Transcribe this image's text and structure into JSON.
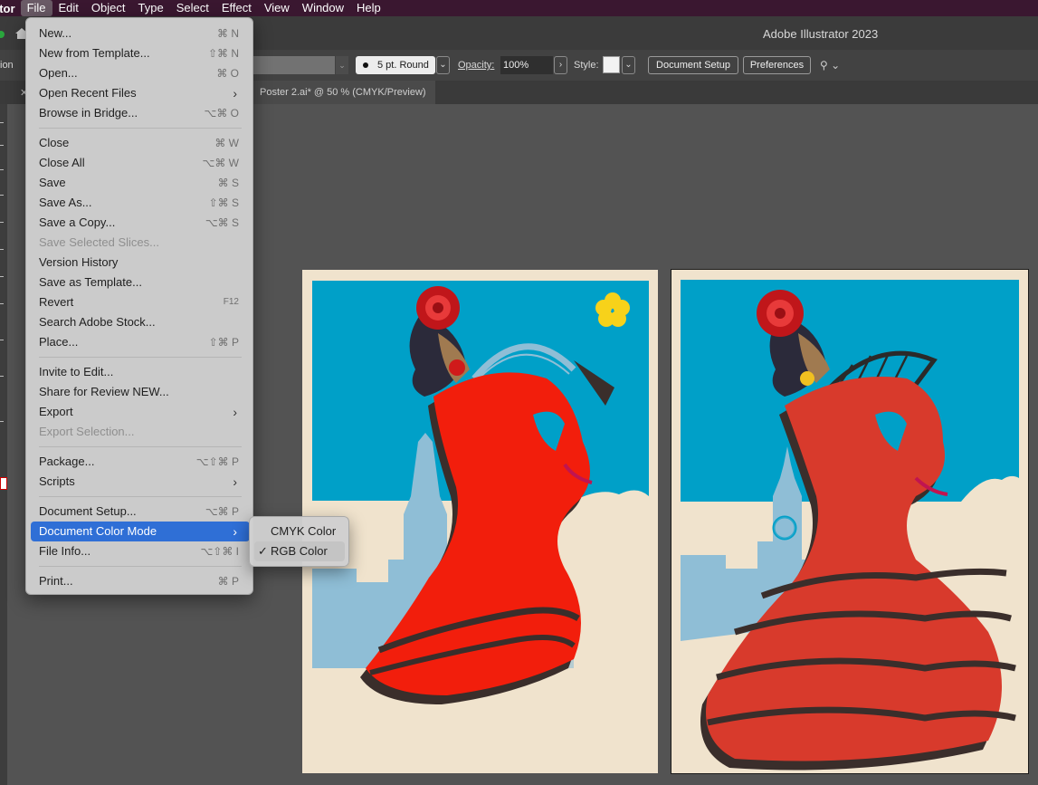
{
  "menubar": {
    "app_name": "Illustrator",
    "items": [
      "File",
      "Edit",
      "Object",
      "Type",
      "Select",
      "Effect",
      "View",
      "Window",
      "Help"
    ]
  },
  "titlebar": {
    "title": "Adobe Illustrator 2023"
  },
  "controlbar": {
    "left_label": "Selection",
    "stroke_profile": "5 pt. Round",
    "opacity_label": "Opacity:",
    "opacity_value": "100%",
    "style_label": "Style:",
    "document_setup": "Document Setup",
    "preferences": "Preferences"
  },
  "tabs": [
    {
      "label": "Poster 2.ai* @ 50 % (CMYK/Preview)"
    }
  ],
  "file_menu": {
    "items": [
      {
        "label": "New...",
        "shortcut": "⌘ N"
      },
      {
        "label": "New from Template...",
        "shortcut": "⇧⌘ N"
      },
      {
        "label": "Open...",
        "shortcut": "⌘ O"
      },
      {
        "label": "Open Recent Files",
        "shortcut": "›"
      },
      {
        "label": "Browse in Bridge...",
        "shortcut": "⌥⌘ O"
      },
      {
        "label": "Close",
        "shortcut": "⌘ W"
      },
      {
        "label": "Close All",
        "shortcut": "⌥⌘ W"
      },
      {
        "label": "Save",
        "shortcut": "⌘ S"
      },
      {
        "label": "Save As...",
        "shortcut": "⇧⌘ S"
      },
      {
        "label": "Save a Copy...",
        "shortcut": "⌥⌘ S"
      },
      {
        "label": "Save Selected Slices...",
        "shortcut": ""
      },
      {
        "label": "Version History",
        "shortcut": ""
      },
      {
        "label": "Save as Template...",
        "shortcut": ""
      },
      {
        "label": "Revert",
        "shortcut": "F12"
      },
      {
        "label": "Search Adobe Stock...",
        "shortcut": ""
      },
      {
        "label": "Place...",
        "shortcut": "⇧⌘ P"
      },
      {
        "label": "Invite to Edit...",
        "shortcut": ""
      },
      {
        "label": "Share for Review NEW...",
        "shortcut": ""
      },
      {
        "label": "Export",
        "shortcut": "›"
      },
      {
        "label": "Export Selection...",
        "shortcut": ""
      },
      {
        "label": "Package...",
        "shortcut": "⌥⇧⌘ P"
      },
      {
        "label": "Scripts",
        "shortcut": "›"
      },
      {
        "label": "Document Setup...",
        "shortcut": "⌥⌘ P"
      },
      {
        "label": "Document Color Mode",
        "shortcut": "›"
      },
      {
        "label": "File Info...",
        "shortcut": "⌥⇧⌘ I"
      },
      {
        "label": "Print...",
        "shortcut": "⌘ P"
      }
    ]
  },
  "color_mode_submenu": {
    "items": [
      {
        "label": "CMYK Color",
        "checked": false
      },
      {
        "label": "RGB Color",
        "checked": true,
        "check": "✓"
      }
    ]
  },
  "colors": {
    "accent": "#2f6fd6",
    "sky": "#00a0c8",
    "dress_cmyk": "#f21e0c",
    "dress_rgb": "#d83a2c",
    "paper": "#f0e3cd"
  }
}
